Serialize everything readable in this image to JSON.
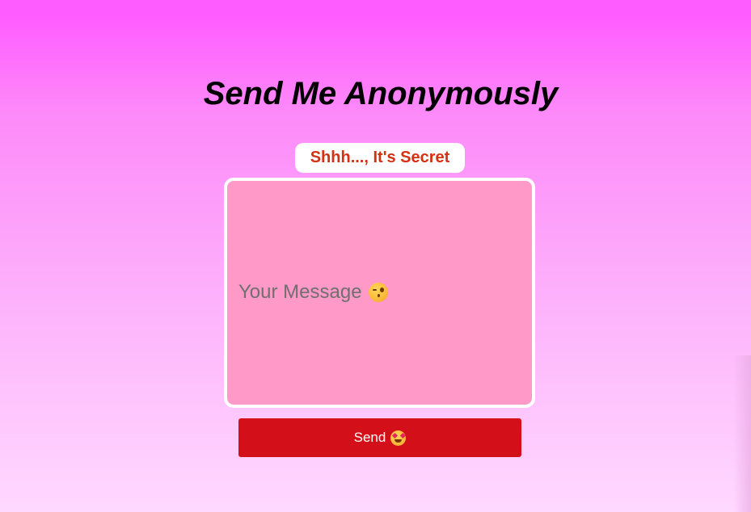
{
  "page": {
    "title": "Send Me Anonymously",
    "badge": "Shhh..., It's Secret"
  },
  "form": {
    "message_placeholder": "Your Message",
    "message_placeholder_icon": "winking-face-icon",
    "message_value": "",
    "send_label": "Send",
    "send_icon": "star-struck-face-icon"
  },
  "colors": {
    "background_top": "#ff5cff",
    "background_bottom": "#ffd9ff",
    "badge_text": "#d33113",
    "textarea_bg": "#ff99c8",
    "button_bg": "#d31019"
  }
}
